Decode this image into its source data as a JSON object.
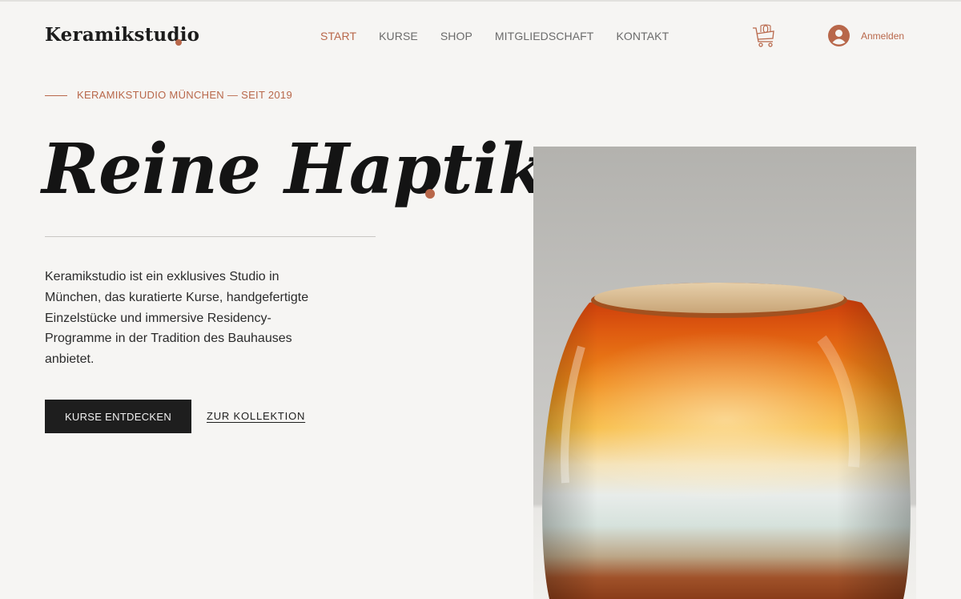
{
  "header": {
    "logo": "Keramikstudio",
    "nav": [
      "START",
      "KURSE",
      "SHOP",
      "MITGLIEDSCHAFT",
      "KONTAKT"
    ],
    "active_nav": "START",
    "cart_count": "0",
    "login_label": "Anmelden"
  },
  "hero": {
    "eyebrow": "KERAMIKSTUDIO MÜNCHEN — SEIT 2019",
    "headline": "Reine Haptik",
    "body": "Keramikstudio ist ein exklusives Studio in München, das kuratierte Kurse, handgefertigte Einzelstücke und immersive Residency-Programme in der Tradition des Bauhauses anbietet.",
    "primary_button": "KURSE ENTDECKEN",
    "secondary_link": "ZUR KOLLEKTION",
    "image_icon": "glazed-ceramic-vessel"
  },
  "colors": {
    "accent": "#b8674a",
    "background": "#f6f5f3",
    "text": "#1c1c1c",
    "button": "#1e1e1e"
  }
}
